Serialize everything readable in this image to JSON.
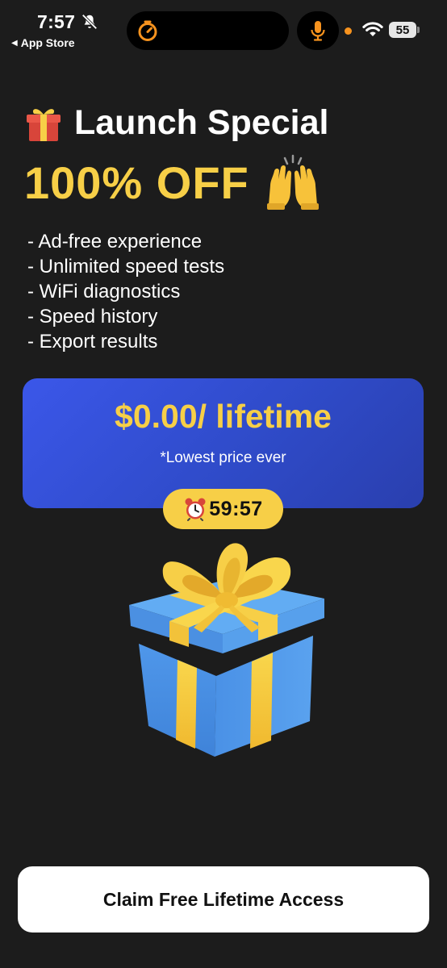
{
  "status_bar": {
    "time": "7:57",
    "back_label": "App Store",
    "battery_level": "55",
    "icons": [
      "bell-slash-icon",
      "timer-icon",
      "microphone-icon",
      "wifi-icon",
      "battery-icon"
    ]
  },
  "headline": {
    "icon": "gift-emoji-icon",
    "title": "Launch Special",
    "discount": "100% OFF",
    "discount_icon": "raised-hands-emoji-icon"
  },
  "features": [
    "- Ad-free experience",
    "- Unlimited speed tests",
    "- WiFi diagnostics",
    "- Speed history",
    "- Export results"
  ],
  "offer": {
    "price": "$0.00/ lifetime",
    "note": "*Lowest price ever",
    "timer_icon": "alarm-clock-emoji-icon",
    "timer": "59:57"
  },
  "cta": {
    "label": "Claim Free Lifetime Access"
  },
  "colors": {
    "background": "#1c1c1c",
    "accent_yellow": "#f7cf47",
    "card_blue": "#3b57e9",
    "gift_blue": "#4a92e6",
    "status_orange": "#f7931e"
  }
}
